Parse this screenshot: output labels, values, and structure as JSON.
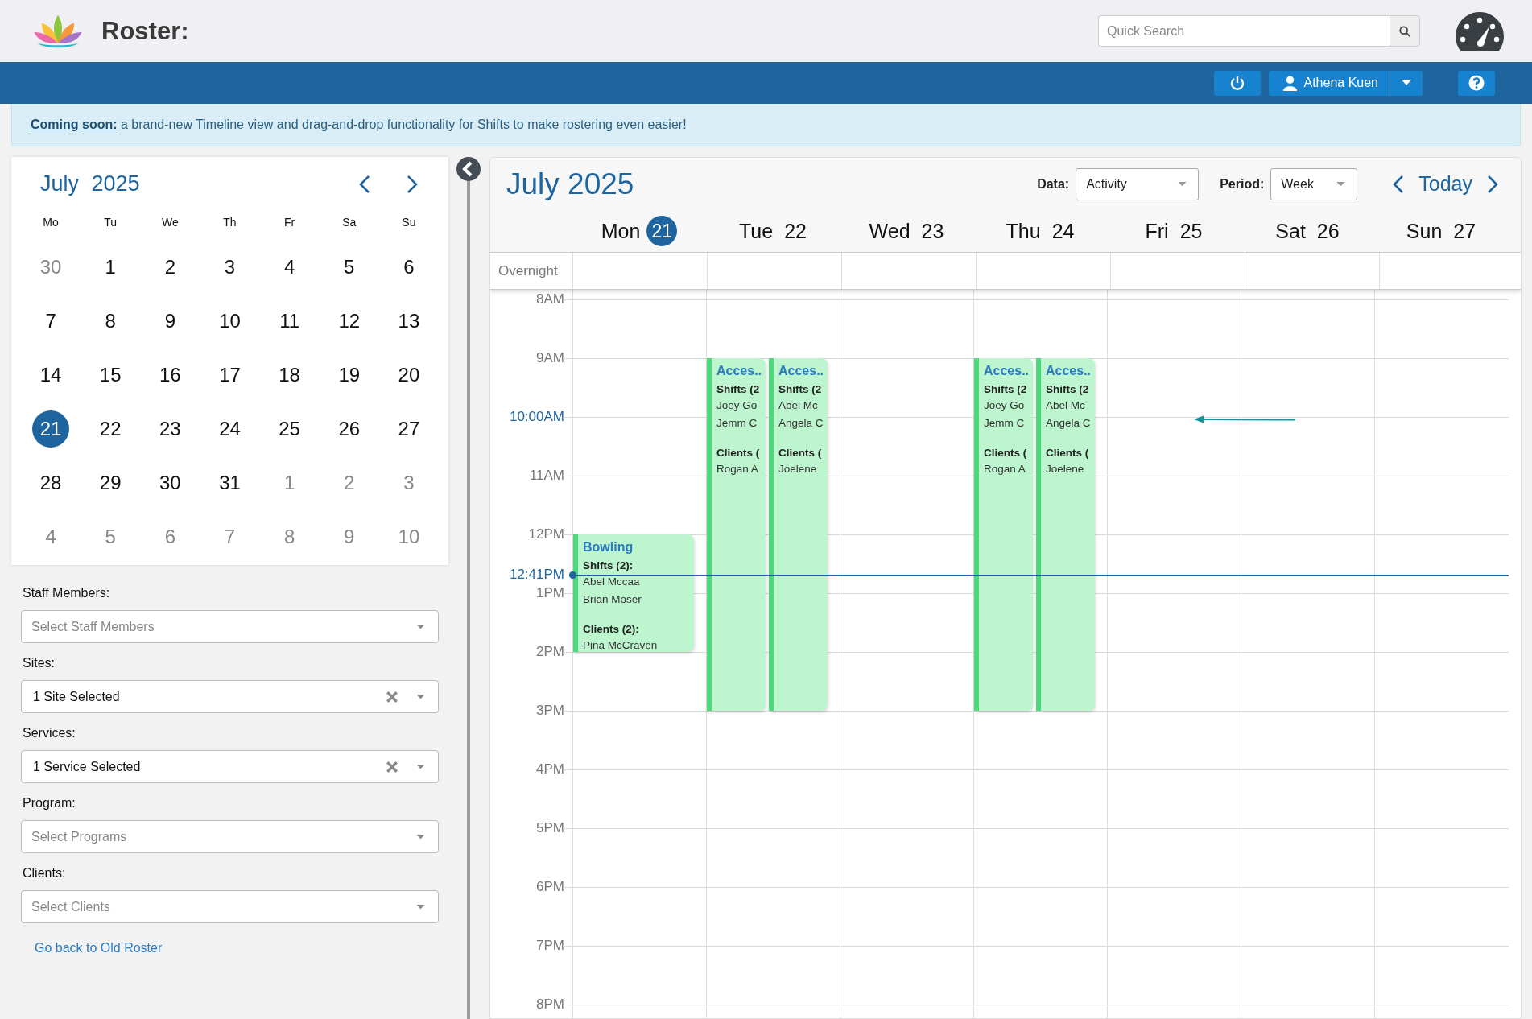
{
  "app": {
    "title": "Roster:"
  },
  "search": {
    "placeholder": "Quick Search"
  },
  "toolbar": {
    "user": "Athena Kuen"
  },
  "banner": {
    "link": "Coming soon:",
    "text": " a brand-new Timeline view and drag-and-drop functionality for Shifts to make rostering even easier!"
  },
  "mini_calendar": {
    "title": "July 2025",
    "weekdays": [
      "Mo",
      "Tu",
      "We",
      "Th",
      "Fr",
      "Sa",
      "Su"
    ],
    "weeks": [
      [
        {
          "day": "30",
          "muted": true,
          "selected": false
        },
        {
          "day": "1",
          "muted": false,
          "selected": false
        },
        {
          "day": "2",
          "muted": false,
          "selected": false
        },
        {
          "day": "3",
          "muted": false,
          "selected": false
        },
        {
          "day": "4",
          "muted": false,
          "selected": false
        },
        {
          "day": "5",
          "muted": false,
          "selected": false
        },
        {
          "day": "6",
          "muted": false,
          "selected": false
        }
      ],
      [
        {
          "day": "7",
          "muted": false,
          "selected": false
        },
        {
          "day": "8",
          "muted": false,
          "selected": false
        },
        {
          "day": "9",
          "muted": false,
          "selected": false
        },
        {
          "day": "10",
          "muted": false,
          "selected": false
        },
        {
          "day": "11",
          "muted": false,
          "selected": false
        },
        {
          "day": "12",
          "muted": false,
          "selected": false
        },
        {
          "day": "13",
          "muted": false,
          "selected": false
        }
      ],
      [
        {
          "day": "14",
          "muted": false,
          "selected": false
        },
        {
          "day": "15",
          "muted": false,
          "selected": false
        },
        {
          "day": "16",
          "muted": false,
          "selected": false
        },
        {
          "day": "17",
          "muted": false,
          "selected": false
        },
        {
          "day": "18",
          "muted": false,
          "selected": false
        },
        {
          "day": "19",
          "muted": false,
          "selected": false
        },
        {
          "day": "20",
          "muted": false,
          "selected": false
        }
      ],
      [
        {
          "day": "21",
          "muted": false,
          "selected": true
        },
        {
          "day": "22",
          "muted": false,
          "selected": false
        },
        {
          "day": "23",
          "muted": false,
          "selected": false
        },
        {
          "day": "24",
          "muted": false,
          "selected": false
        },
        {
          "day": "25",
          "muted": false,
          "selected": false
        },
        {
          "day": "26",
          "muted": false,
          "selected": false
        },
        {
          "day": "27",
          "muted": false,
          "selected": false
        }
      ],
      [
        {
          "day": "28",
          "muted": false,
          "selected": false
        },
        {
          "day": "29",
          "muted": false,
          "selected": false
        },
        {
          "day": "30",
          "muted": false,
          "selected": false
        },
        {
          "day": "31",
          "muted": false,
          "selected": false
        },
        {
          "day": "1",
          "muted": true,
          "selected": false
        },
        {
          "day": "2",
          "muted": true,
          "selected": false
        },
        {
          "day": "3",
          "muted": true,
          "selected": false
        }
      ],
      [
        {
          "day": "4",
          "muted": true,
          "selected": false
        },
        {
          "day": "5",
          "muted": true,
          "selected": false
        },
        {
          "day": "6",
          "muted": true,
          "selected": false
        },
        {
          "day": "7",
          "muted": true,
          "selected": false
        },
        {
          "day": "8",
          "muted": true,
          "selected": false
        },
        {
          "day": "9",
          "muted": true,
          "selected": false
        },
        {
          "day": "10",
          "muted": true,
          "selected": false
        }
      ]
    ]
  },
  "filters": [
    {
      "label": "Staff Members:",
      "placeholder": "Select Staff Members",
      "clearable": false
    },
    {
      "label": "Sites:",
      "value": "1 Site Selected",
      "clearable": true
    },
    {
      "label": "Services:",
      "value": "1 Service Selected",
      "clearable": true
    },
    {
      "label": "Program:",
      "placeholder": "Select Programs",
      "clearable": false
    },
    {
      "label": "Clients:",
      "placeholder": "Select Clients",
      "clearable": false
    }
  ],
  "back_link": "Go back to Old Roster",
  "calendar": {
    "title": "July 2025",
    "data_filter": {
      "label": "Data:",
      "value": "Activity"
    },
    "period_filter": {
      "label": "Period:",
      "value": "Week"
    },
    "today_button": "Today",
    "overnight_label": "Overnight",
    "time_labels": [
      {
        "label": "8AM",
        "kind": "hour"
      },
      {
        "label": "9AM",
        "kind": "hour"
      },
      {
        "label": "10:00AM",
        "kind": "hover"
      },
      {
        "label": "11AM",
        "kind": "hour"
      },
      {
        "label": "12PM",
        "kind": "hour"
      },
      {
        "label": "12:41PM",
        "kind": "now"
      },
      {
        "label": "1PM",
        "kind": "hour"
      },
      {
        "label": "2PM",
        "kind": "hour"
      },
      {
        "label": "3PM",
        "kind": "hour"
      },
      {
        "label": "4PM",
        "kind": "hour"
      },
      {
        "label": "5PM",
        "kind": "hour"
      },
      {
        "label": "6PM",
        "kind": "hour"
      },
      {
        "label": "7PM",
        "kind": "hour"
      },
      {
        "label": "8PM",
        "kind": "hour"
      }
    ],
    "days": [
      {
        "name": "Mon",
        "date": "21",
        "today": true,
        "events": [
          {
            "title": "Bowling",
            "sections": [
              {
                "heading": "Shifts (2):",
                "names": [
                  "Abel Mccaa",
                  "Brian Moser"
                ]
              },
              {
                "heading": "Clients (2):",
                "names": [
                  "Pina McCraven"
                ]
              }
            ]
          }
        ]
      },
      {
        "name": "Tue",
        "date": "22",
        "today": false,
        "events": [
          {
            "title": "Acces..",
            "sections": [
              {
                "heading": "Shifts (2",
                "names": [
                  "Joey Go",
                  "Jemm C"
                ]
              },
              {
                "heading": "Clients (",
                "names": [
                  "Rogan A"
                ]
              }
            ]
          },
          {
            "title": "Acces..",
            "sections": [
              {
                "heading": "Shifts (2",
                "names": [
                  "Abel Mc",
                  "Angela C"
                ]
              },
              {
                "heading": "Clients (",
                "names": [
                  "Joelene"
                ]
              }
            ]
          }
        ]
      },
      {
        "name": "Wed",
        "date": "23",
        "today": false
      },
      {
        "name": "Thu",
        "date": "24",
        "today": false,
        "events": [
          {
            "title": "Acces..",
            "sections": [
              {
                "heading": "Shifts (2",
                "names": [
                  "Joey Go",
                  "Jemm C"
                ]
              },
              {
                "heading": "Clients (",
                "names": [
                  "Rogan A"
                ]
              }
            ]
          },
          {
            "title": "Acces..",
            "sections": [
              {
                "heading": "Shifts (2",
                "names": [
                  "Abel Mc",
                  "Angela C"
                ]
              },
              {
                "heading": "Clients (",
                "names": [
                  "Joelene"
                ]
              }
            ]
          }
        ]
      },
      {
        "name": "Fri",
        "date": "25",
        "today": false
      },
      {
        "name": "Sat",
        "date": "26",
        "today": false
      },
      {
        "name": "Sun",
        "date": "27",
        "today": false
      }
    ]
  }
}
